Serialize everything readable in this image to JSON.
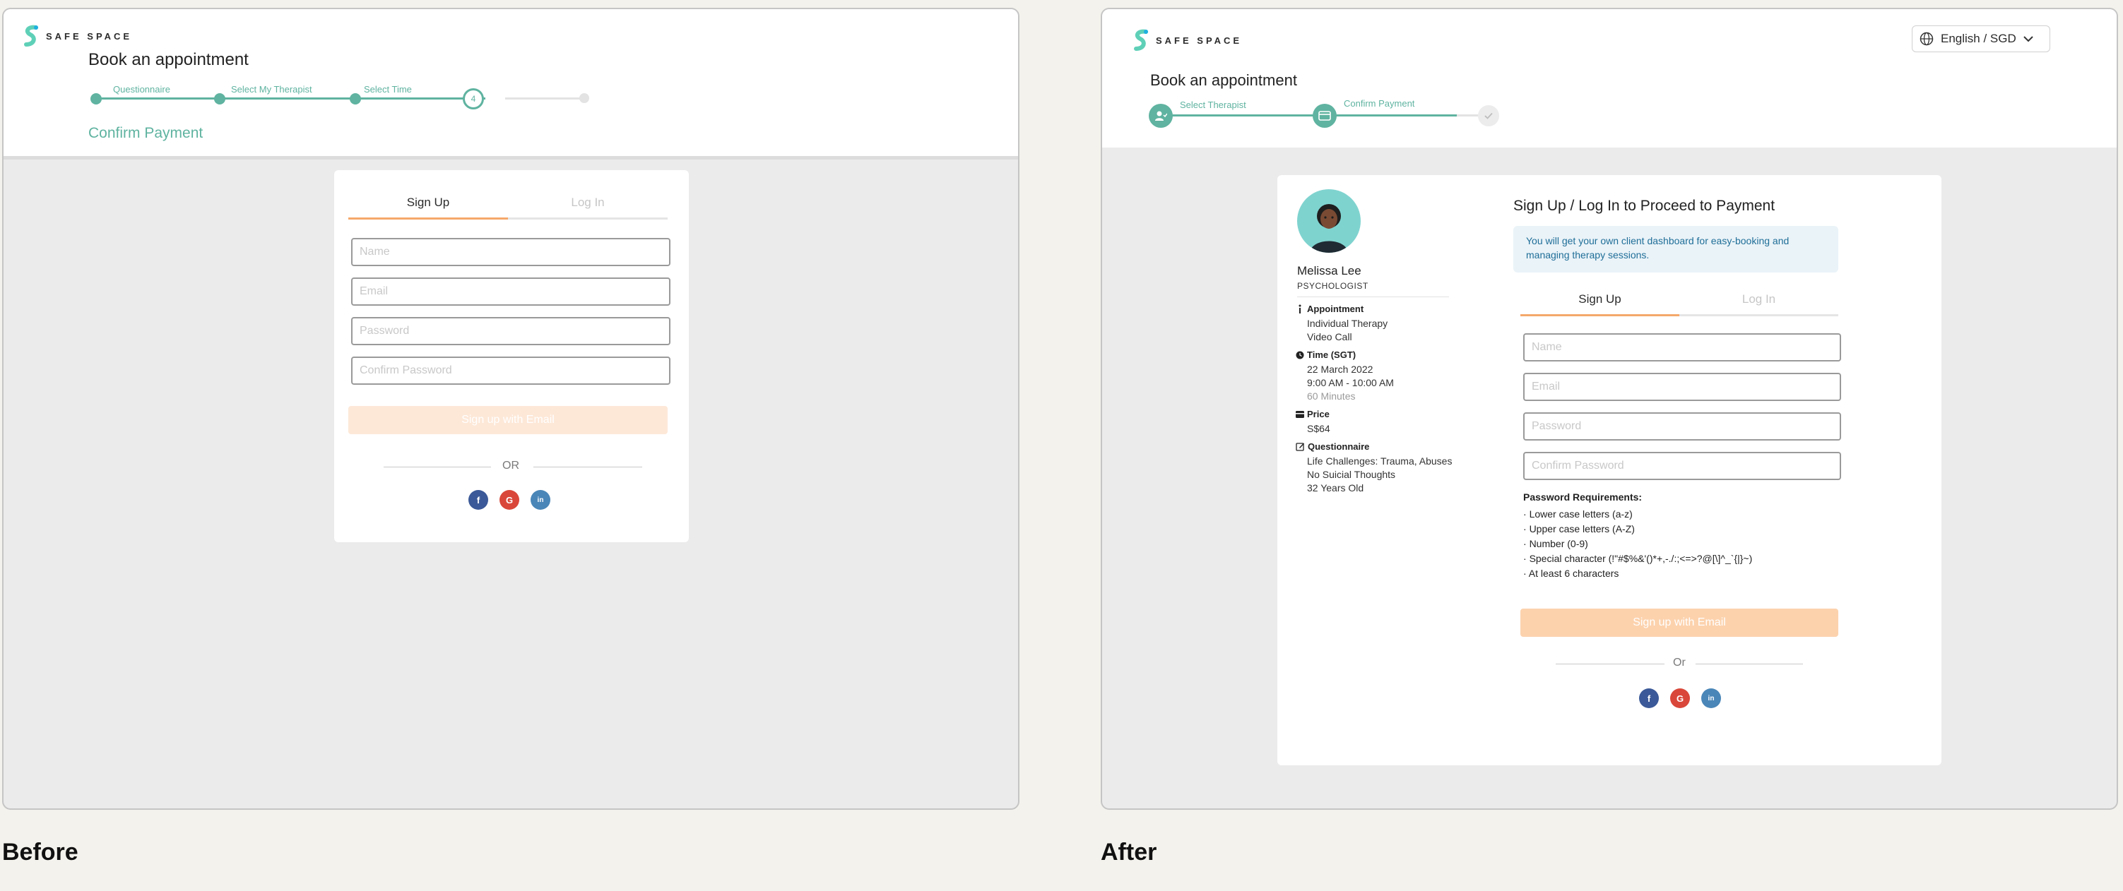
{
  "colors": {
    "teal": "#5fb3a0",
    "orange": "#f5a86b",
    "grey_bg": "#ebebeb",
    "caption": "#111111"
  },
  "before": {
    "caption": "Before",
    "brand": "SAFE SPACE",
    "title": "Book an appointment",
    "steps": [
      "Questionnaire",
      "Select My Therapist",
      "Select Time"
    ],
    "current_step_number": "4",
    "section_title": "Confirm Payment",
    "tabs": {
      "signup": "Sign Up",
      "login": "Log In"
    },
    "fields": {
      "name": "Name",
      "email": "Email",
      "password": "Password",
      "confirm": "Confirm Password"
    },
    "cta": "Sign up with Email",
    "or": "OR",
    "social": {
      "facebook": "f",
      "google": "G",
      "linkedin": "in"
    }
  },
  "after": {
    "caption": "After",
    "brand": "SAFE SPACE",
    "language": "English / SGD",
    "title": "Book an appointment",
    "steps": [
      "Select Therapist",
      "Confirm Payment"
    ],
    "therapist": {
      "name": "Melissa Lee",
      "role": "PSYCHOLOGIST"
    },
    "appointment": {
      "label": "Appointment",
      "lines": [
        "Individual Therapy",
        "Video Call"
      ]
    },
    "time": {
      "label": "Time (SGT)",
      "lines": [
        "22 March 2022",
        "9:00 AM - 10:00 AM"
      ],
      "muted": "60 Minutes"
    },
    "price": {
      "label": "Price",
      "lines": [
        "S$64"
      ]
    },
    "questionnaire": {
      "label": "Questionnaire",
      "lines": [
        "Life Challenges: Trauma, Abuses",
        "No Suicial Thoughts",
        "32 Years Old"
      ]
    },
    "panel_title": "Sign Up / Log In to Proceed to Payment",
    "notice": "You will get your own client dashboard for easy-booking and managing therapy sessions.",
    "tabs": {
      "signup": "Sign Up",
      "login": "Log In"
    },
    "fields": {
      "name": "Name",
      "email": "Email",
      "password": "Password",
      "confirm": "Confirm Password"
    },
    "password_req_title": "Password Requirements:",
    "password_reqs": [
      "Lower case letters (a-z)",
      "Upper case letters (A-Z)",
      "Number (0-9)",
      "Special character (!\"#$%&'()*+,-./:;<=>?@[\\]^_`{|}~)",
      "At least 6 characters"
    ],
    "cta": "Sign up with Email",
    "or": "Or",
    "social": {
      "facebook": "f",
      "google": "G",
      "linkedin": "in"
    }
  }
}
